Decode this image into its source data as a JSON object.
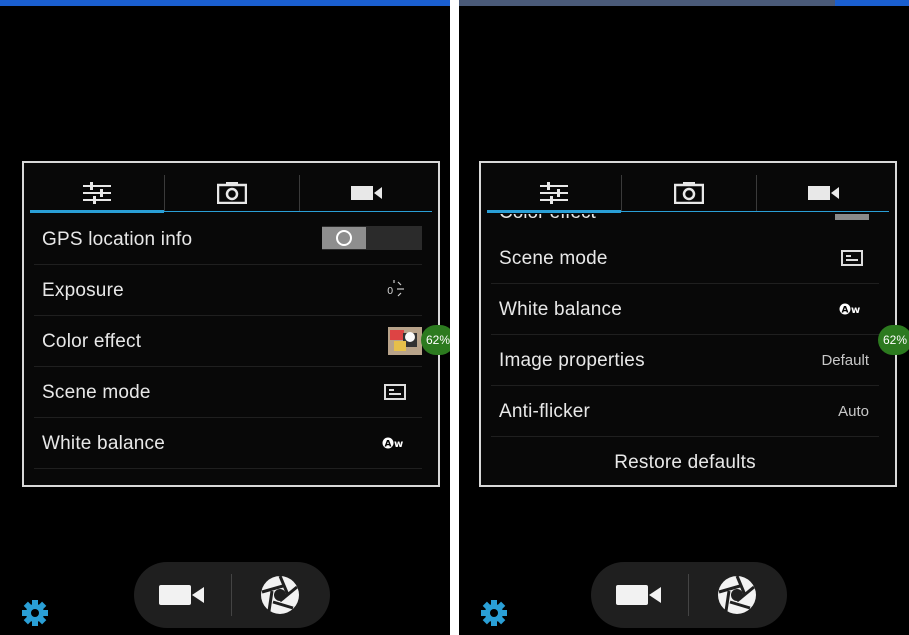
{
  "left": {
    "tabs": [
      {
        "name": "settings-sliders-icon"
      },
      {
        "name": "camera-icon"
      },
      {
        "name": "video-camera-icon"
      }
    ],
    "rows": [
      {
        "label": "GPS location info",
        "control": "toggle",
        "state": "off"
      },
      {
        "label": "Exposure",
        "control": "icon",
        "icon": "exposure-icon"
      },
      {
        "label": "Color effect",
        "control": "icon",
        "icon": "color-effect-thumbnail"
      },
      {
        "label": "Scene mode",
        "control": "icon",
        "icon": "scene-mode-icon"
      },
      {
        "label": "White balance",
        "control": "icon",
        "icon": "auto-white-balance-icon"
      }
    ],
    "battery_badge": "62%"
  },
  "right": {
    "partial_row_label": "Color effect",
    "rows": [
      {
        "label": "Scene mode",
        "control": "icon",
        "icon": "scene-mode-icon"
      },
      {
        "label": "White balance",
        "control": "icon",
        "icon": "auto-white-balance-icon"
      },
      {
        "label": "Image properties",
        "value": "Default"
      },
      {
        "label": "Anti-flicker",
        "value": "Auto"
      }
    ],
    "restore_label": "Restore defaults",
    "battery_badge": "62%"
  },
  "bottom_controls": {
    "video_button": "video-camera-icon",
    "shutter_button": "shutter-icon",
    "settings_button": "gear-icon"
  },
  "colors": {
    "accent": "#2a9fd6",
    "panel_border": "#d8d8d8",
    "background": "#000000",
    "battery_badge": "#2c7a1f",
    "gear": "#2a9fd6",
    "status_bar": "#1a5fd0"
  }
}
